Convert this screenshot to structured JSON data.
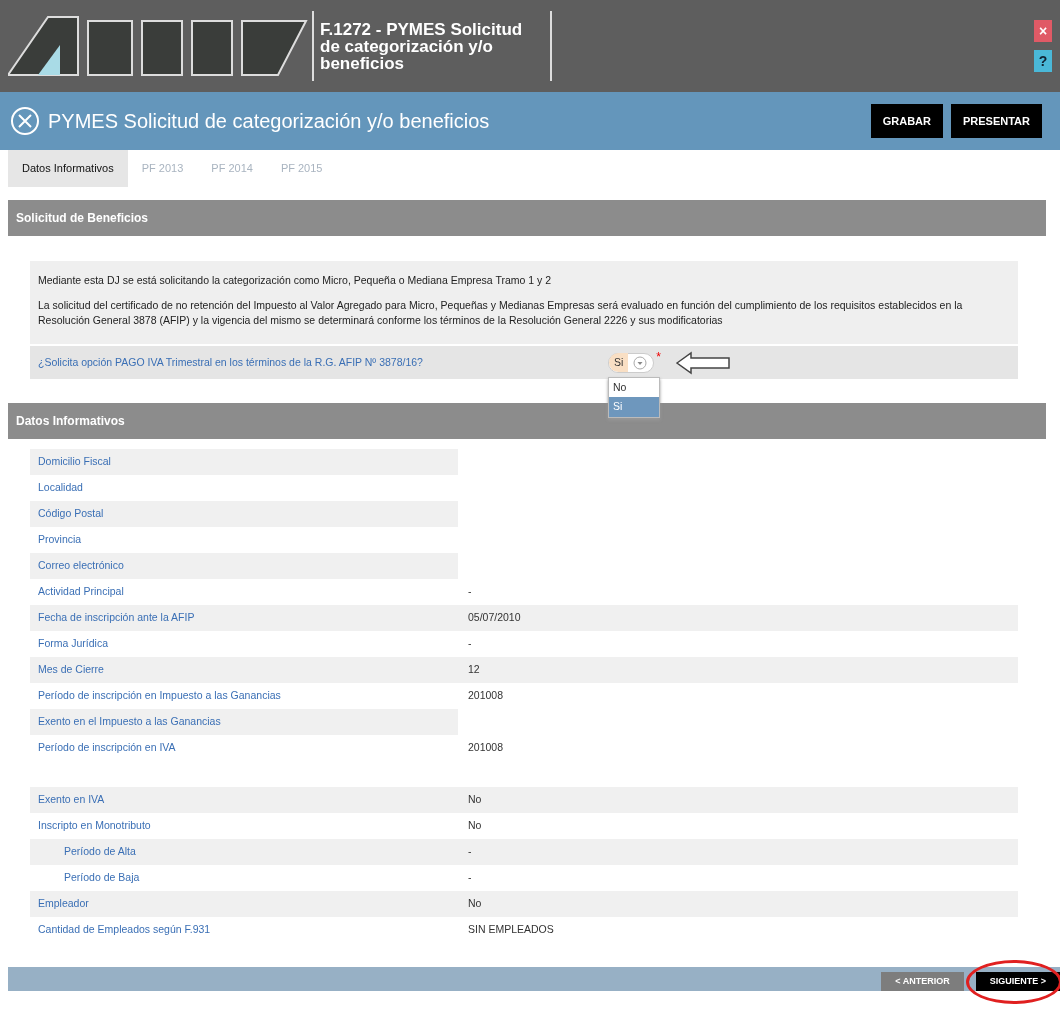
{
  "header": {
    "title_lines": [
      "F.1272 - PYMES Solicitud",
      "de categorización y/o",
      "beneficios"
    ],
    "close": "×",
    "help": "?"
  },
  "toolbar": {
    "title": "PYMES Solicitud de categorización y/o beneficios",
    "buttons": [
      "GRABAR",
      "PRESENTAR"
    ]
  },
  "tabs": [
    {
      "label": "Datos Informativos",
      "selected": true
    },
    {
      "label": "PF 2013",
      "selected": false
    },
    {
      "label": "PF 2014",
      "selected": false
    },
    {
      "label": "PF 2015",
      "selected": false
    }
  ],
  "solicitud": {
    "title": "Solicitud de Beneficios",
    "paragraphs": [
      "Mediante esta DJ se está solicitando la categorización como Micro, Pequeña o Mediana Empresa Tramo 1 y 2",
      "La solicitud del certificado de no retención del Impuesto al Valor Agregado para Micro, Pequeñas y Medianas Empresas será evaluado en función del cumplimiento de los requisitos establecidos en la Resolución General 3878 (AFIP) y la vigencia del mismo se determinará conforme los términos de la Resolución General 2226 y sus modificatorias"
    ],
    "question": {
      "text": "¿Solicita opción PAGO IVA Trimestral en los términos de la R.G. AFIP Nº 3878/16?",
      "value": "Si",
      "required_mark": "*",
      "expanded": true,
      "options": [
        {
          "label": "No",
          "selected": false
        },
        {
          "label": "Si",
          "selected": true
        }
      ]
    }
  },
  "datos": {
    "title": "Datos Informativos",
    "groups": [
      {
        "rows": [
          {
            "label": "Domicilio Fiscal"
          },
          {
            "label": "Localidad"
          },
          {
            "label": "Código Postal"
          },
          {
            "label": "Provincia"
          },
          {
            "label": "Correo electrónico"
          },
          {
            "label": "Actividad Principal",
            "value": "-"
          },
          {
            "label": "Fecha de inscripción ante la AFIP",
            "value": "05/07/2010"
          },
          {
            "label": "Forma Jurídica",
            "value": "-"
          },
          {
            "label": "Mes de Cierre",
            "value": "12"
          },
          {
            "label": "Período de inscripción en Impuesto a las Ganancias",
            "value": "201008"
          },
          {
            "label": "Exento en el Impuesto a las Ganancias"
          },
          {
            "label": "Período de inscripción en IVA",
            "value": "201008"
          }
        ]
      },
      {
        "rows": [
          {
            "label": "Exento en IVA",
            "value": "No"
          },
          {
            "label": "Inscripto en Monotributo",
            "value": "No",
            "children": [
              {
                "label": "Período de Alta",
                "value": "-"
              },
              {
                "label": "Período de Baja",
                "value": "-"
              }
            ]
          },
          {
            "label": "Empleador",
            "value": "No"
          },
          {
            "label": "Cantidad de Empleados según F.931",
            "value": "SIN EMPLEADOS"
          }
        ]
      }
    ]
  },
  "footer": {
    "buttons": [
      {
        "label": "< ANTERIOR",
        "kind": "secondary"
      },
      {
        "label": "SIGUIENTE >",
        "kind": "primary",
        "highlighted": true
      }
    ]
  }
}
